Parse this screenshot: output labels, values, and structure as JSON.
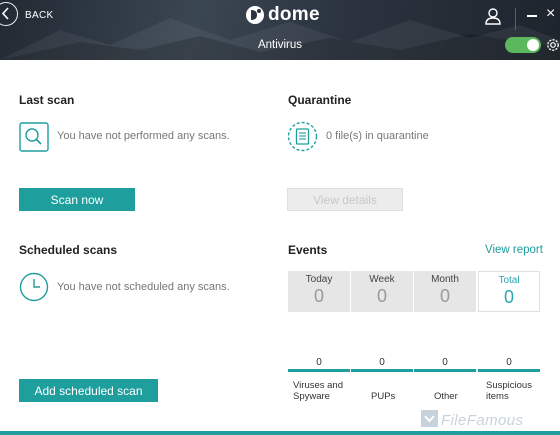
{
  "header": {
    "back_label": "BACK",
    "logo_text": "dome",
    "page_title": "Antivirus",
    "antivirus_enabled": true
  },
  "last_scan": {
    "title": "Last scan",
    "status": "You have not performed any scans.",
    "button": "Scan now"
  },
  "quarantine": {
    "title": "Quarantine",
    "status": "0 file(s) in quarantine",
    "button": "View details"
  },
  "scheduled": {
    "title": "Scheduled scans",
    "status": "You have not scheduled any scans.",
    "button": "Add scheduled scan"
  },
  "events": {
    "title": "Events",
    "link": "View report",
    "periods": [
      {
        "label": "Today",
        "value": "0"
      },
      {
        "label": "Week",
        "value": "0"
      },
      {
        "label": "Month",
        "value": "0"
      },
      {
        "label": "Total",
        "value": "0"
      }
    ],
    "active_period": "Total",
    "categories": [
      {
        "count": "0",
        "label_line1": "Viruses and",
        "label_line2": "Spyware"
      },
      {
        "count": "0",
        "label_line1": "PUPs",
        "label_line2": ""
      },
      {
        "count": "0",
        "label_line1": "Other",
        "label_line2": ""
      },
      {
        "count": "0",
        "label_line1": "Suspicious",
        "label_line2": "items"
      }
    ]
  },
  "watermark": "FileFamous",
  "colors": {
    "accent": "#1f9e9e",
    "toggle_on": "#5cb85c",
    "header_bg": "#2b3440"
  }
}
